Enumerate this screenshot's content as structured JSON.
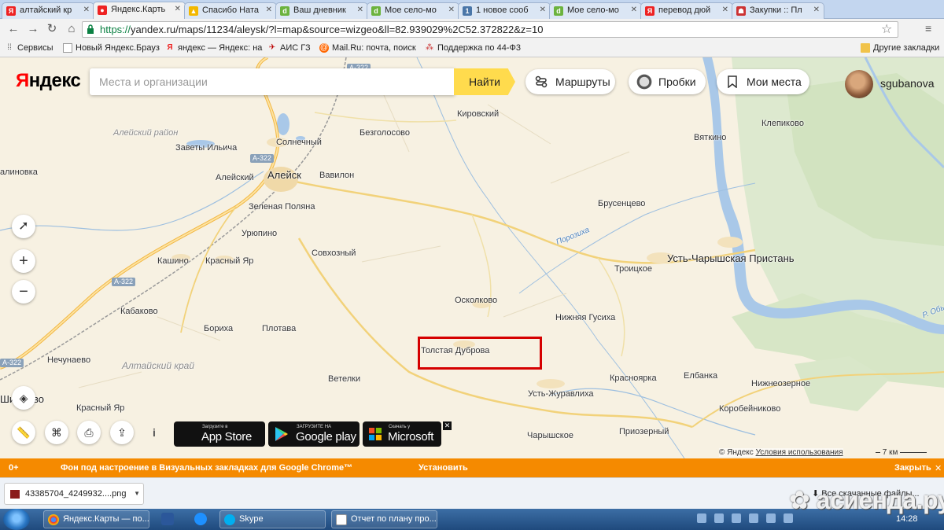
{
  "tabs": [
    {
      "label": "алтайский кр",
      "fav": "Я",
      "color": "#e22"
    },
    {
      "label": "Яндекс.Карть",
      "fav": "●",
      "color": "#e22",
      "active": true
    },
    {
      "label": "Спасибо Ната",
      "fav": "▲",
      "color": "#f3b800"
    },
    {
      "label": "Ваш дневник",
      "fav": "d",
      "color": "#6cb33e"
    },
    {
      "label": "Мое село-мо",
      "fav": "d",
      "color": "#6cb33e"
    },
    {
      "label": "1 новое сооб",
      "fav": "1",
      "color": "#4a76a8"
    },
    {
      "label": "Мое село-мо",
      "fav": "d",
      "color": "#6cb33e"
    },
    {
      "label": "перевод дюй",
      "fav": "Я",
      "color": "#e22"
    },
    {
      "label": "Закупки :: Пл",
      "fav": "☗",
      "color": "#c33"
    }
  ],
  "address": {
    "scheme": "https://",
    "rest": "yandex.ru/maps/11234/aleysk/?l=map&source=wizgeo&ll=82.939029%2C52.372822&z=10"
  },
  "bookmarks": [
    {
      "label": "Сервисы",
      "icon": "apps-icon"
    },
    {
      "label": "Новый Яндекс.Брауз",
      "icon": "page-icon"
    },
    {
      "label": "яндекс — Яндекс: на",
      "icon": "yandex-icon"
    },
    {
      "label": "АИС ГЗ",
      "icon": "ais-icon"
    },
    {
      "label": "Mail.Ru: почта, поиск",
      "icon": "mail-icon"
    },
    {
      "label": "Поддержка по 44-Ф3",
      "icon": "support-icon"
    }
  ],
  "other_bookmarks": "Другие закладки",
  "yandex": {
    "logo_first": "Я",
    "logo_rest": "ндекс",
    "search_placeholder": "Места и организации",
    "find": "Найти",
    "routes": "Маршруты",
    "traffic": "Пробки",
    "my_places": "Мои места",
    "username": "sgubanova"
  },
  "map": {
    "places": [
      {
        "name": "Кировский",
        "cls": "place"
      },
      {
        "name": "Безголосово",
        "cls": "place"
      },
      {
        "name": "Солнечный",
        "cls": "place"
      },
      {
        "name": "Заветы Ильича",
        "cls": "place"
      },
      {
        "name": "Алейский район",
        "cls": "place region"
      },
      {
        "name": "алиновка",
        "cls": "place"
      },
      {
        "name": "Алейск",
        "cls": "place big"
      },
      {
        "name": "Вавилон",
        "cls": "place"
      },
      {
        "name": "Алейский",
        "cls": "place"
      },
      {
        "name": "Зеленая Поляна",
        "cls": "place"
      },
      {
        "name": "Урюпино",
        "cls": "place"
      },
      {
        "name": "Совхозный",
        "cls": "place"
      },
      {
        "name": "Кашино",
        "cls": "place"
      },
      {
        "name": "Красный Яр",
        "cls": "place"
      },
      {
        "name": "Кабаково",
        "cls": "place"
      },
      {
        "name": "Бориха",
        "cls": "place"
      },
      {
        "name": "Плотава",
        "cls": "place"
      },
      {
        "name": "Алтайский край",
        "cls": "place regbig"
      },
      {
        "name": "Нечунаево",
        "cls": "place"
      },
      {
        "name": "Ветелки",
        "cls": "place"
      },
      {
        "name": "Ши",
        "cls": "place big"
      },
      {
        "name": "во",
        "cls": "place big"
      },
      {
        "name": "Красный Яр",
        "cls": "place"
      },
      {
        "name": "Осколково",
        "cls": "place"
      },
      {
        "name": "Толстая Дуброва",
        "cls": "place"
      },
      {
        "name": "Брусенцево",
        "cls": "place"
      },
      {
        "name": "Порозиха",
        "cls": "place river"
      },
      {
        "name": "Троицкое",
        "cls": "place"
      },
      {
        "name": "Усть-Чарышская Пристань",
        "cls": "place big"
      },
      {
        "name": "Нижняя Гусиха",
        "cls": "place"
      },
      {
        "name": "Усть-Журавлиха",
        "cls": "place"
      },
      {
        "name": "Красноярка",
        "cls": "place"
      },
      {
        "name": "Елбанка",
        "cls": "place"
      },
      {
        "name": "Нижнеозерное",
        "cls": "place"
      },
      {
        "name": "Коробейниково",
        "cls": "place"
      },
      {
        "name": "Чарышское",
        "cls": "place"
      },
      {
        "name": "Приозерный",
        "cls": "place"
      },
      {
        "name": "Клепиково",
        "cls": "place"
      },
      {
        "name": "Вяткино",
        "cls": "place"
      },
      {
        "name": "Р. Обь",
        "cls": "place river"
      }
    ],
    "road_labels": [
      "А-322",
      "А-322",
      "А-322",
      "А-322"
    ],
    "copyright": "© Яндекс",
    "terms": "Условия использования",
    "scale": "7 км"
  },
  "stores": [
    {
      "small": "Загрузите в",
      "big": "App Store"
    },
    {
      "small": "ЗАГРУЗИТЕ НА",
      "big": "Google play"
    },
    {
      "small": "Скачать у",
      "big": "Microsoft"
    }
  ],
  "infobar": {
    "text": "Фон под настроение в Визуальных закладках для Google Chrome™",
    "prefix": "0+",
    "install": "Установить",
    "close": "Закрыть"
  },
  "download": {
    "file": "43385704_4249932....png",
    "all": "Все скачанные файлы..."
  },
  "taskbar": {
    "items": [
      "Яндекс.Карты — по...",
      "Skype",
      "Отчет по плану про..."
    ],
    "clock": "14:28"
  },
  "watermark": "асиенда.ру"
}
